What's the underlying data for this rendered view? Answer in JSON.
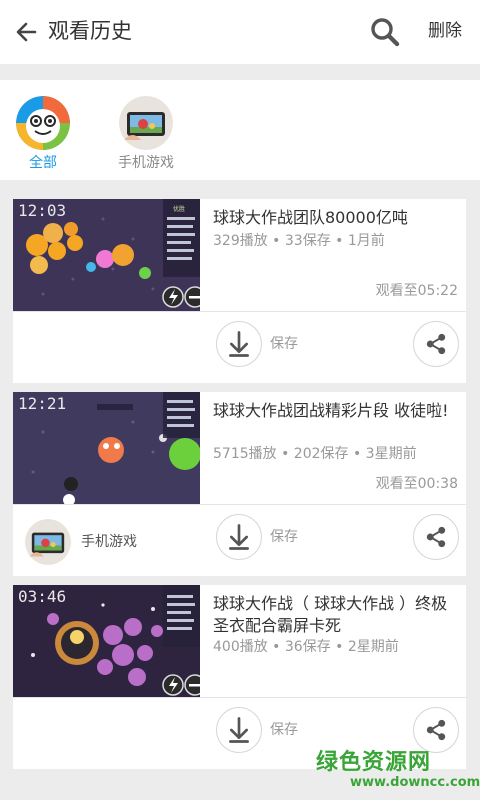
{
  "header": {
    "title": "观看历史",
    "delete_label": "删除"
  },
  "filters": [
    {
      "label": "全部",
      "selected": true
    },
    {
      "label": "手机游戏",
      "selected": false
    }
  ],
  "videos": [
    {
      "duration": "12:03",
      "title": "球球大作战团队80000亿吨",
      "meta": "329播放 • 33保存 • 1月前",
      "watched": "观看至05:22",
      "save_label": "保存"
    },
    {
      "duration": "12:21",
      "title": "球球大作战团战精彩片段 收徒啦!",
      "meta": "5715播放 • 202保存 • 3星期前",
      "watched": "观看至00:38",
      "source": "手机游戏",
      "save_label": "保存"
    },
    {
      "duration": "03:46",
      "title": "球球大作战（ 球球大作战 ）终极圣衣配合霸屏卡死",
      "meta": "400播放 • 36保存 • 2星期前",
      "save_label": "保存"
    }
  ],
  "watermark": {
    "name": "绿色资源网",
    "url": "www.downcc.com"
  },
  "colors": {
    "accent": "#1a9be6",
    "background": "#ececec",
    "watermark": "#3aa537"
  }
}
